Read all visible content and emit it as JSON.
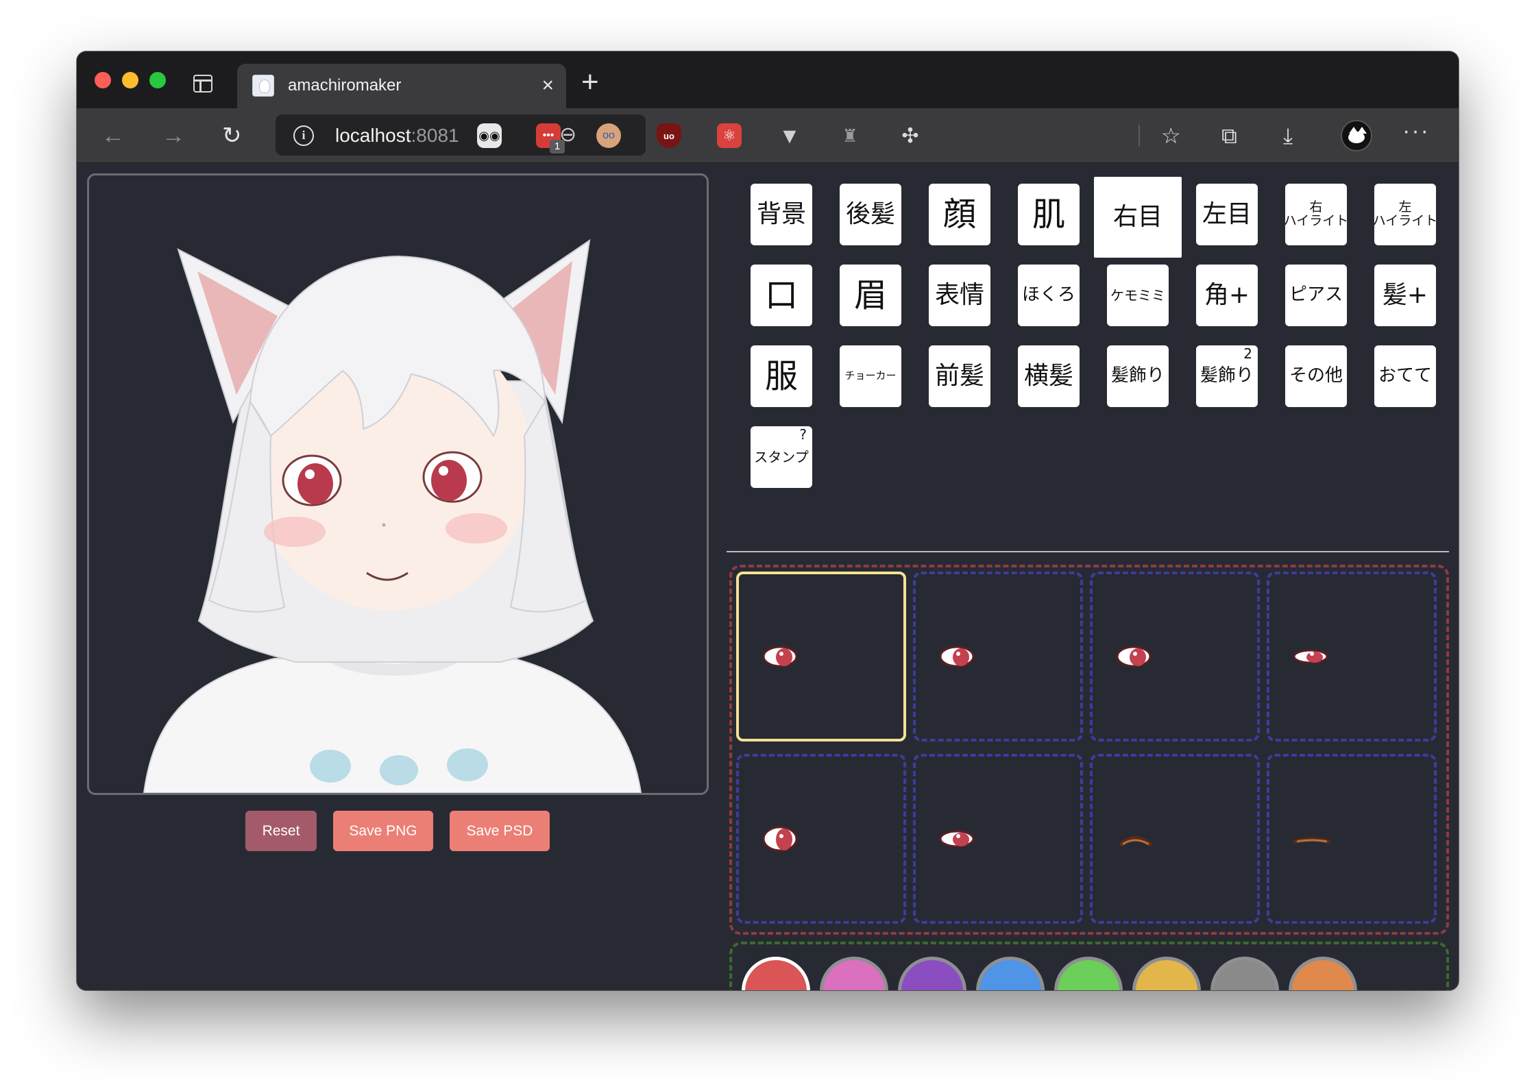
{
  "browser": {
    "tab_title": "amachiromaker",
    "tab_close": "×",
    "new_tab": "+",
    "url_host": "localhost",
    "url_port": ":8081",
    "extension_badge": "1",
    "more_menu": "···"
  },
  "actions": {
    "reset": "Reset",
    "save_png": "Save PNG",
    "save_psd": "Save PSD"
  },
  "categories": [
    {
      "label": "背景"
    },
    {
      "label": "後髪"
    },
    {
      "label": "顔"
    },
    {
      "label": "肌"
    },
    {
      "label": "右目",
      "selected": true
    },
    {
      "label": "左目"
    },
    {
      "label": "右\nハイライト"
    },
    {
      "label": "左\nハイライト"
    },
    {
      "label": "口"
    },
    {
      "label": "眉"
    },
    {
      "label": "表情"
    },
    {
      "label": "ほくろ"
    },
    {
      "label": "ケモミミ"
    },
    {
      "label": "角+"
    },
    {
      "label": "ピアス"
    },
    {
      "label": "髪+"
    },
    {
      "label": "服"
    },
    {
      "label": "チョーカー"
    },
    {
      "label": "前髪"
    },
    {
      "label": "横髪"
    },
    {
      "label": "髪飾り"
    },
    {
      "label": "髪飾り",
      "sup": "2"
    },
    {
      "label": "その他"
    },
    {
      "label": "おてて"
    },
    {
      "label": "スタンプ",
      "sup": "?"
    }
  ],
  "parts": [
    {
      "style": "eye-open",
      "selected": true
    },
    {
      "style": "eye-open"
    },
    {
      "style": "eye-open"
    },
    {
      "style": "eye-narrow"
    },
    {
      "style": "eye-wide"
    },
    {
      "style": "eye-half"
    },
    {
      "style": "eye-closed-curve"
    },
    {
      "style": "eye-closed-line"
    }
  ],
  "colors": [
    {
      "name": "red",
      "hex": "#d95556",
      "selected": true
    },
    {
      "name": "pink",
      "hex": "#db70bf"
    },
    {
      "name": "purple",
      "hex": "#8a4ec0"
    },
    {
      "name": "blue",
      "hex": "#4f94e6"
    },
    {
      "name": "green",
      "hex": "#6bcf59"
    },
    {
      "name": "yellow",
      "hex": "#e2b64a"
    },
    {
      "name": "gray",
      "hex": "#8a8a8a"
    },
    {
      "name": "orange",
      "hex": "#e0894c"
    }
  ]
}
